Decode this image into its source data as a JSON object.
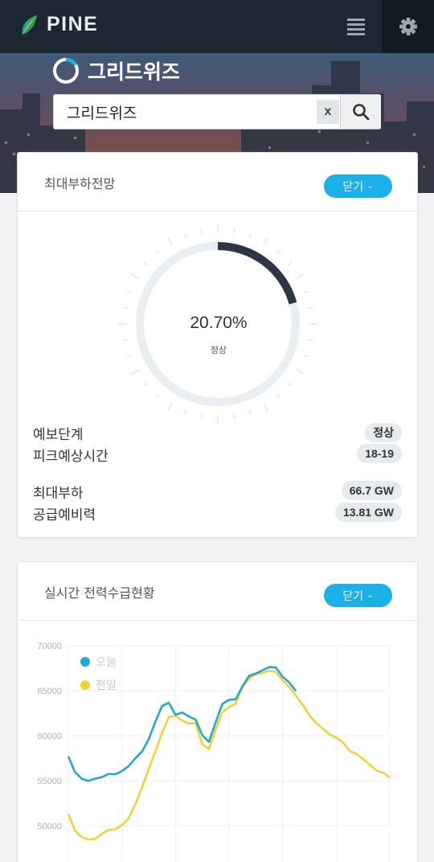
{
  "app": {
    "brand": "PINE"
  },
  "icons": {
    "logo": "leaf-logo",
    "menu": "list-icon",
    "settings": "gear-icon",
    "site": "ring-icon",
    "clear": "close-icon",
    "search": "search-icon"
  },
  "colors": {
    "topbar": "#1d2731",
    "accent": "#1ab0e8",
    "gauge_fill": "#2e3547",
    "gauge_track": "#e8eef1",
    "today": "#1fa8d8",
    "yesterday": "#f2d23a"
  },
  "site": {
    "title": "그리드위즈"
  },
  "search": {
    "value": "그리드위즈",
    "clear_label": "x"
  },
  "max_load": {
    "title": "최대부하전망",
    "toggle_label": "닫기",
    "gauge": {
      "percent": 20.7,
      "percent_label": "20.70%",
      "status": "정상"
    },
    "rows": [
      {
        "label": "예보단계",
        "value": "정상"
      },
      {
        "label": "피크예상시간",
        "value": "18-19"
      },
      {
        "label": "최대부하",
        "value": "66.7 GW"
      },
      {
        "label": "공급예비력",
        "value": "13.81 GW"
      }
    ]
  },
  "realtime": {
    "title": "실시간 전력수급현황",
    "toggle_label": "닫기"
  },
  "chart_data": {
    "type": "line",
    "ylim": [
      45000,
      70000
    ],
    "yticks": [
      "70000",
      "65000",
      "60000",
      "55000",
      "50000"
    ],
    "x": [
      0,
      0.5,
      1,
      1.5,
      2,
      2.5,
      3,
      3.5,
      4,
      4.5,
      5,
      5.5,
      6,
      6.5,
      7,
      7.5,
      8,
      8.5,
      9,
      9.5,
      10,
      10.5,
      11,
      11.5,
      12,
      12.5,
      13,
      13.5,
      14,
      14.5,
      15,
      15.5,
      16,
      16.5,
      17,
      17.5,
      18,
      18.5,
      19,
      19.5,
      20,
      20.5,
      21,
      21.5,
      22,
      22.5,
      23,
      23.5,
      24
    ],
    "series": [
      {
        "name": "오늘",
        "color": "#1fa8d8",
        "values": [
          57800,
          56000,
          55200,
          54900,
          55300,
          55400,
          55700,
          55800,
          56100,
          56600,
          57400,
          58300,
          59600,
          61500,
          63400,
          63700,
          62300,
          62500,
          62200,
          61800,
          60000,
          59400,
          61500,
          63500,
          63900,
          64100,
          65500,
          66600,
          67000,
          67300,
          67600,
          67500,
          66600,
          65900,
          64900,
          null,
          null,
          null,
          null,
          null,
          null,
          null,
          null,
          null,
          null,
          null,
          null,
          null,
          null
        ]
      },
      {
        "name": "전일",
        "color": "#f2d23a",
        "values": [
          51400,
          49500,
          48700,
          48400,
          48600,
          49100,
          49500,
          49700,
          50100,
          50800,
          52300,
          54300,
          56300,
          58200,
          60400,
          62100,
          62200,
          61600,
          61400,
          61400,
          59000,
          58600,
          60700,
          62600,
          63100,
          63600,
          65400,
          66300,
          66900,
          67000,
          67200,
          67000,
          66200,
          65400,
          64400,
          63500,
          62300,
          61400,
          60700,
          60200,
          59800,
          59200,
          58400,
          58000,
          57400,
          56700,
          56200,
          55900,
          55300
        ]
      }
    ]
  }
}
